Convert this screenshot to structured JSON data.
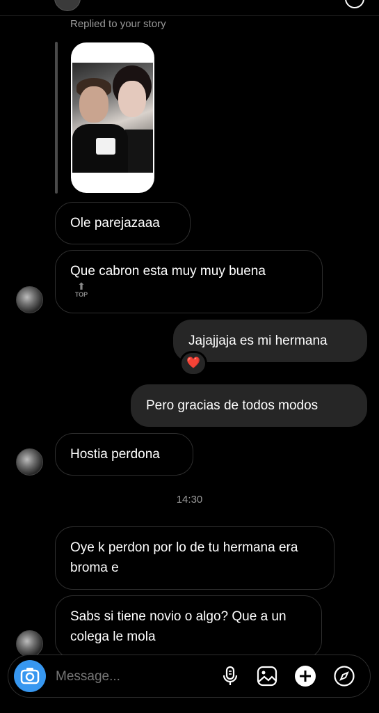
{
  "thread": {
    "story_reply_label": "Replied to your story",
    "story_image": "story-photo-couple",
    "messages": [
      {
        "side": "incoming",
        "text": "Ole parejazaaa"
      },
      {
        "side": "incoming",
        "text": "Que cabron esta muy muy buena",
        "tag": "TOP"
      },
      {
        "side": "outgoing",
        "text": "Jajajjaja es mi hermana",
        "reaction": "❤️"
      },
      {
        "side": "outgoing",
        "text": "Pero gracias de todos modos"
      },
      {
        "side": "incoming",
        "text": "Hostia perdona"
      },
      {
        "side": "incoming",
        "text": "Oye k perdon por lo de tu hermana era broma e"
      },
      {
        "side": "incoming",
        "text": "Sabs si tiene novio o algo? Que a un colega le mola"
      }
    ],
    "timestamp": "14:30"
  },
  "composer": {
    "placeholder": "Message...",
    "icons": [
      "camera-icon",
      "microphone-icon",
      "gallery-icon",
      "add-icon",
      "sticker-compass-icon"
    ]
  },
  "colors": {
    "background": "#000000",
    "incoming_border": "#2e2e2e",
    "outgoing_bubble": "#262626",
    "camera_button": "#3797f0",
    "heart": "#ff3040"
  }
}
